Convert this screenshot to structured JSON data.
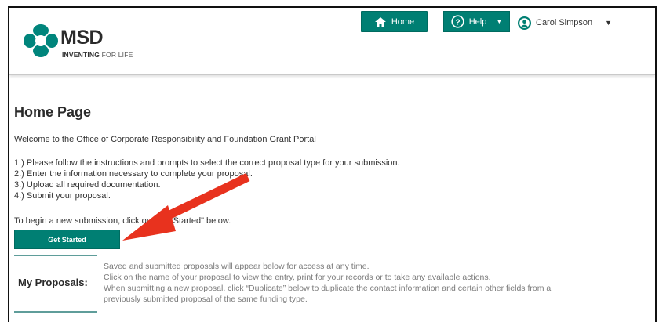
{
  "brand": {
    "name": "MSD",
    "tagline_strong": "INVENTING",
    "tagline_light": " FOR LIFE",
    "primary_color": "#007f73",
    "logo_color": "#00857c"
  },
  "header": {
    "home_label": "Home",
    "help_label": "Help",
    "user_name": "Carol Simpson"
  },
  "main": {
    "title": "Home Page",
    "welcome": "Welcome to the Office of Corporate Responsibility and Foundation Grant Portal",
    "steps": [
      "1.) Please follow the instructions and prompts to select the correct proposal type for your submission.",
      "2.) Enter the information necessary to complete your proposal.",
      "3.) Upload all required documentation.",
      "4.) Submit your proposal."
    ],
    "begin_text": "To begin a new submission, click on \"Get Started\" below.",
    "get_started_label": "Get Started"
  },
  "proposals": {
    "label": "My Proposals:",
    "lines": [
      "Saved and submitted proposals will appear below for access at any time.",
      "Click on the name of your proposal to view the entry, print for your records or to take any available actions.",
      "When submitting a new proposal, click “Duplicate” below to duplicate the contact information and certain other fields from a",
      "previously submitted proposal of the same funding type."
    ]
  },
  "annotation": {
    "arrow_color": "#e8321e"
  }
}
